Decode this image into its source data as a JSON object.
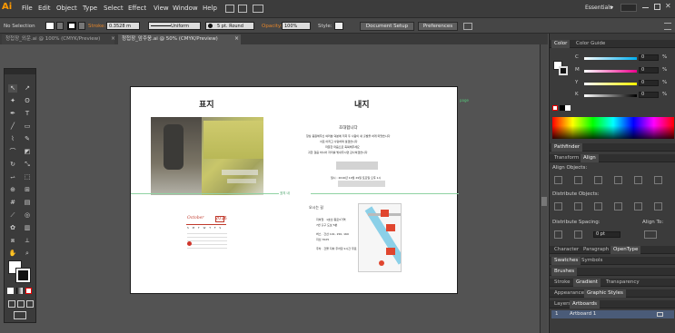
{
  "app": {
    "logo": "Ai"
  },
  "menu": {
    "items": [
      "File",
      "Edit",
      "Object",
      "Type",
      "Select",
      "Effect",
      "View",
      "Window",
      "Help"
    ]
  },
  "workspace": {
    "label": "Essentials",
    "caret": "▾"
  },
  "control": {
    "selection": "No Selection",
    "stroke_label": "Stroke:",
    "stroke_value": "0.3528 m",
    "profile": "Uniform",
    "brush": "5 pt. Round",
    "opacity_label": "Opacity:",
    "opacity_value": "100%",
    "style_label": "Style:",
    "document_setup": "Document Setup",
    "preferences": "Preferences"
  },
  "tabs": [
    {
      "label": "청첩장_외운.ai @ 100% (CMYK/Preview)",
      "close": "×",
      "active": false
    },
    {
      "label": "청첩장_앞주웅.ai @ 50% (CMYK/Preview)",
      "close": "×",
      "active": true
    }
  ],
  "artboard": {
    "cover_title": "표지",
    "inner_title": "내지",
    "page_label": "page",
    "fold_label": "표지 내",
    "invite_title": "초대합니다",
    "invite_lines": [
      "항상 응원해주신 여러분 덕분에 저희 두 사람이 새 출발을 하게 되었습니다",
      "서로 아끼고 사랑하며 살겠습니다",
      "따뜻한 마음으로 축복해주세요",
      "귀한 걸음 하시어 자리를 빛내주시면 감사하겠습니다"
    ],
    "date_label": "일시 : 2016년 10월 29일 토요일 오후 1시",
    "calendar_month": "October",
    "calendar_year": "2016",
    "calendar_days": [
      "S",
      "M",
      "T",
      "W",
      "T",
      "F",
      "S"
    ],
    "directions_title": "오시는 길",
    "directions_lines": [
      "지하철 · 1호선 종로3가역",
      "7번 출구 도보 5분",
      "버스 · 간선 101, 150, 160",
      "지선 7025",
      "주차 · 건물 지하 주차장 2시간 무료"
    ]
  },
  "panels": {
    "color": {
      "tabs": [
        "Color",
        "Color Guide"
      ],
      "channels": [
        {
          "label": "C",
          "value": "0",
          "unit": "%",
          "color": "#00aeef"
        },
        {
          "label": "M",
          "value": "0",
          "unit": "%",
          "color": "#ec008c"
        },
        {
          "label": "Y",
          "value": "0",
          "unit": "%",
          "color": "#fff200"
        },
        {
          "label": "K",
          "value": "0",
          "unit": "%",
          "color": "#333333"
        }
      ]
    },
    "pathfinder": "Pathfinder",
    "transform_tabs": [
      "Transform",
      "Align"
    ],
    "align_objects": "Align Objects:",
    "distribute_objects": "Distribute Objects:",
    "distribute_spacing": "Distribute Spacing:",
    "align_to": "Align To:",
    "spacing_value": "0 pt",
    "type_tabs": [
      "Character",
      "Paragraph",
      "OpenType"
    ],
    "swatch_tabs": [
      "Swatches",
      "Symbols"
    ],
    "brushes": "Brushes",
    "stroke_tabs": [
      "Stroke",
      "Gradient",
      "Transparency"
    ],
    "appearance_tabs": [
      "Appearance",
      "Graphic Styles"
    ],
    "layers_tabs": [
      "Layers",
      "Artboards"
    ],
    "artboard_row": {
      "index": "1",
      "name": "Artboard 1"
    }
  }
}
